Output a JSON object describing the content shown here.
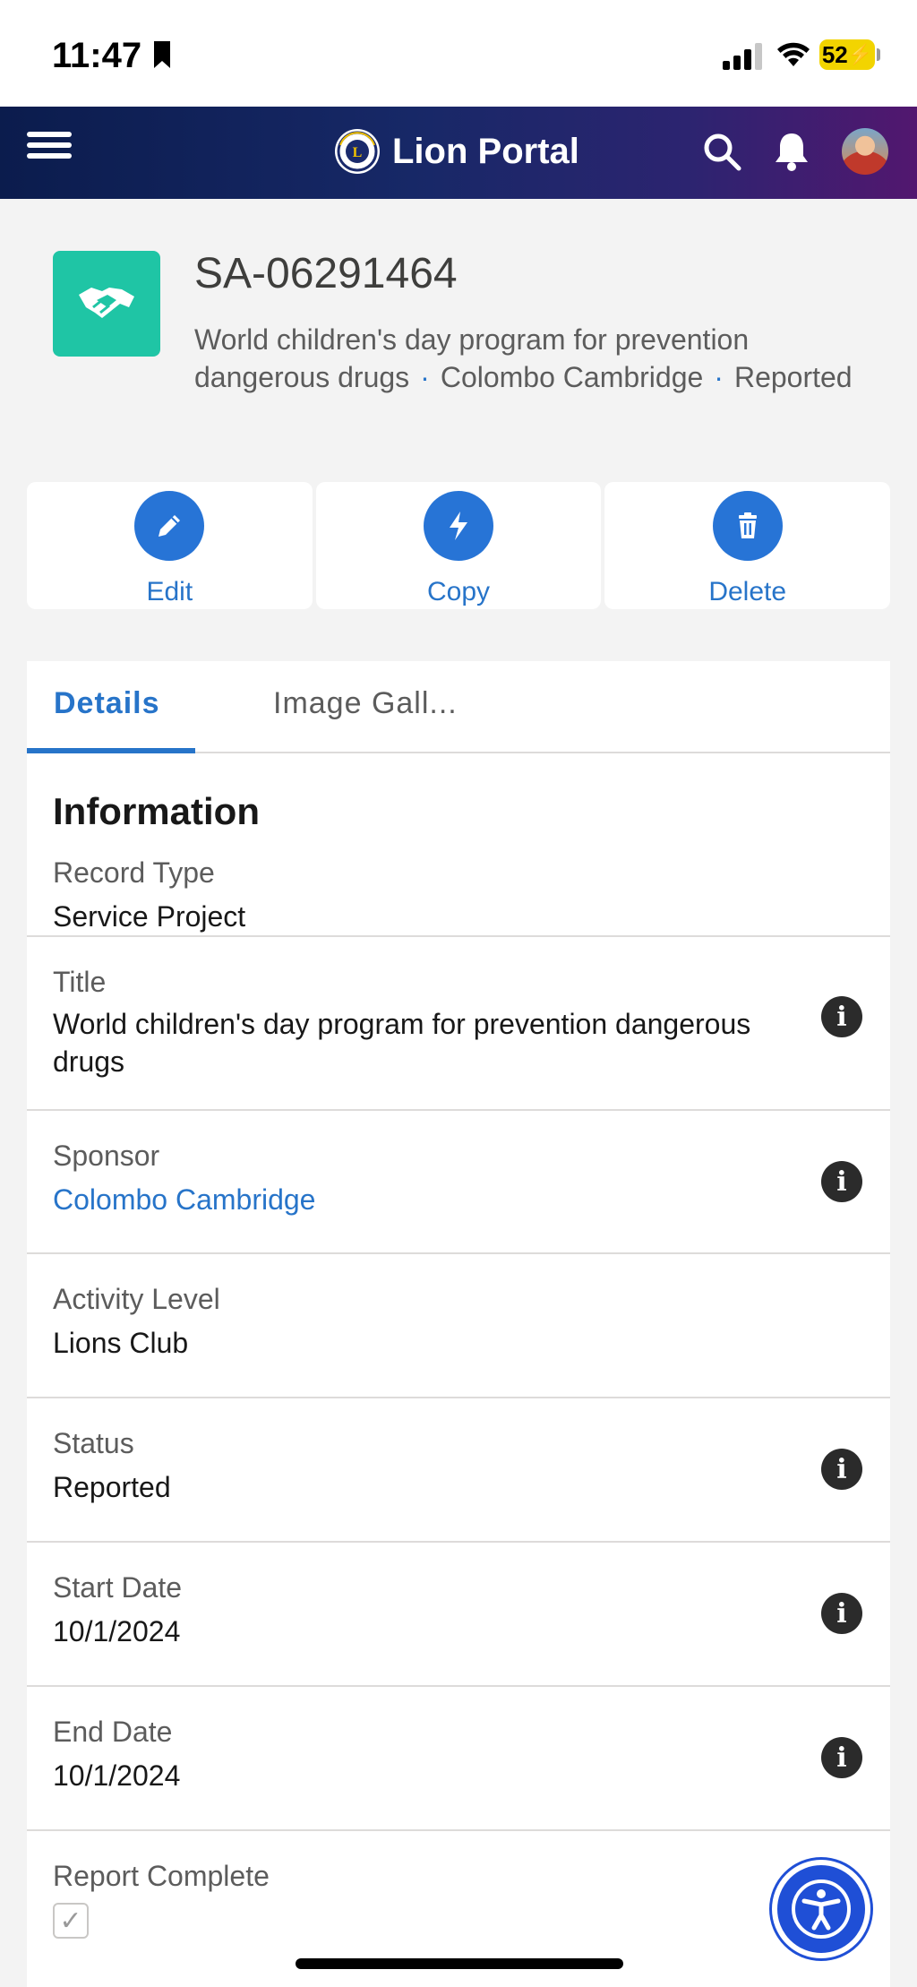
{
  "status_bar": {
    "time": "11:47",
    "battery": "52"
  },
  "header": {
    "app_name": "Lion Portal",
    "logo_text": "LIONS"
  },
  "record": {
    "id": "SA-06291464",
    "subtitle": {
      "title": "World children's day program for prevention dangerous drugs",
      "sponsor": "Colombo Cambridge",
      "status": "Reported"
    }
  },
  "actions": [
    {
      "label": "Edit",
      "icon": "pencil-icon"
    },
    {
      "label": "Copy",
      "icon": "lightning-icon"
    },
    {
      "label": "Delete",
      "icon": "trash-icon"
    }
  ],
  "tabs": {
    "details": "Details",
    "gallery": "Image Gall..."
  },
  "section": {
    "title": "Information"
  },
  "fields": {
    "record_type": {
      "label": "Record Type",
      "value": "Service Project"
    },
    "title": {
      "label": "Title",
      "value": "World children's day program for prevention dangerous drugs"
    },
    "sponsor": {
      "label": "Sponsor",
      "value": "Colombo Cambridge"
    },
    "activity_level": {
      "label": "Activity Level",
      "value": "Lions Club"
    },
    "status": {
      "label": "Status",
      "value": "Reported"
    },
    "start_date": {
      "label": "Start Date",
      "value": "10/1/2024"
    },
    "end_date": {
      "label": "End Date",
      "value": "10/1/2024"
    },
    "report_complete": {
      "label": "Report Complete",
      "checked": true
    }
  },
  "colors": {
    "accent": "#2774c9",
    "record_icon": "#1fc5a5",
    "header_start": "#0b1c4d",
    "header_end": "#52176f"
  }
}
